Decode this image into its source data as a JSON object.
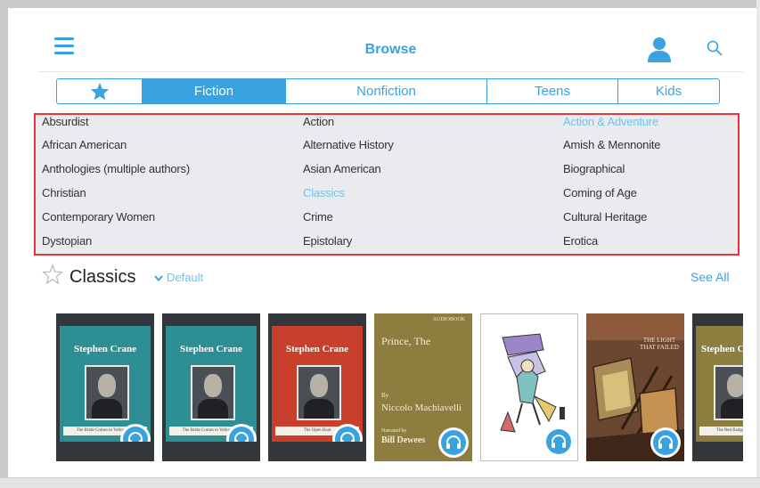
{
  "header": {
    "title": "Browse",
    "menu_icon": "hamburger-menu-icon",
    "user_icon": "user-icon",
    "search_icon": "search-icon",
    "accent_color": "#3aa3df"
  },
  "tabs": [
    {
      "label": "",
      "icon": "star-icon",
      "active": false
    },
    {
      "label": "Fiction",
      "active": true
    },
    {
      "label": "Nonfiction",
      "active": false
    },
    {
      "label": "Teens",
      "active": false
    },
    {
      "label": "Kids",
      "active": false
    }
  ],
  "genres": {
    "highlight_color": "#e8343a",
    "items": [
      {
        "label": "Absurdist",
        "selected": false
      },
      {
        "label": "Action",
        "selected": false
      },
      {
        "label": "Action & Adventure",
        "selected": true
      },
      {
        "label": "African American",
        "selected": false
      },
      {
        "label": "Alternative History",
        "selected": false
      },
      {
        "label": "Amish & Mennonite",
        "selected": false
      },
      {
        "label": "Anthologies (multiple authors)",
        "selected": false
      },
      {
        "label": "Asian American",
        "selected": false
      },
      {
        "label": "Biographical",
        "selected": false
      },
      {
        "label": "Christian",
        "selected": false
      },
      {
        "label": "Classics",
        "selected": true
      },
      {
        "label": "Coming of Age",
        "selected": false
      },
      {
        "label": "Contemporary Women",
        "selected": false
      },
      {
        "label": "Crime",
        "selected": false
      },
      {
        "label": "Cultural Heritage",
        "selected": false
      },
      {
        "label": "Dystopian",
        "selected": false
      },
      {
        "label": "Epistolary",
        "selected": false
      },
      {
        "label": "Erotica",
        "selected": false
      }
    ]
  },
  "section": {
    "title": "Classics",
    "sort_label": "Default",
    "see_all": "See All",
    "star_icon": "star-outline-icon"
  },
  "books": [
    {
      "author": "Stephen Crane",
      "plate": "The Bride Comes to Yellow Sky",
      "style": "teal"
    },
    {
      "author": "Stephen Crane",
      "plate": "The Bride Comes to Yellow Sky",
      "style": "teal"
    },
    {
      "author": "Stephen Crane",
      "plate": "The Open Boat",
      "style": "red"
    },
    {
      "publisher": "AUDIOBOOK",
      "title": "Prince, The",
      "by": "By",
      "author": "Niccolo Machiavelli",
      "narrated": "Narrated by",
      "narrator": "Bill Dewees",
      "style": "olive"
    },
    {
      "style": "illustration"
    },
    {
      "title": "THE LIGHT THAT FAILED",
      "style": "painting"
    },
    {
      "author": "Stephen Crane",
      "plate": "The Red Badge",
      "style": "partial"
    }
  ],
  "audio_badge_icon": "headphones-icon"
}
